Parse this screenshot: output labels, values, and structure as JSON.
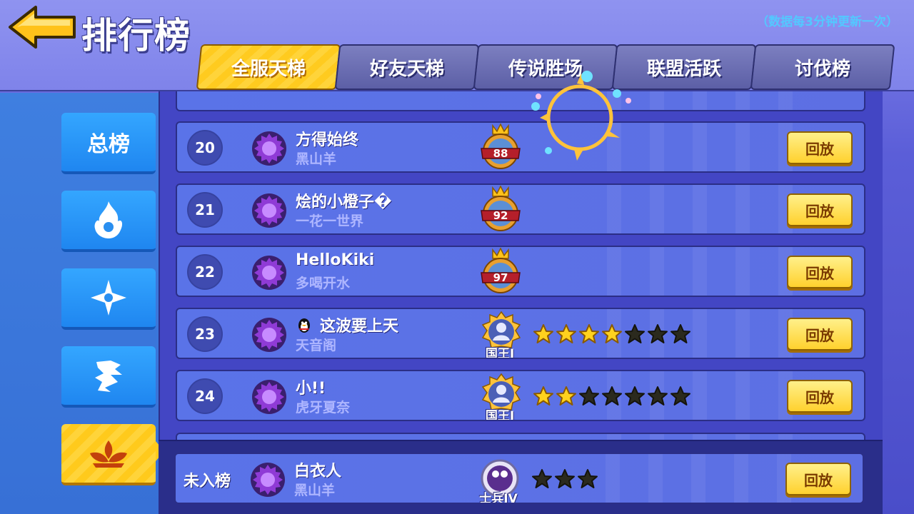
{
  "header": {
    "title": "排行榜",
    "update_note": "（数据每3分钟更新一次）"
  },
  "tabs": [
    {
      "label": "全服天梯",
      "active": true
    },
    {
      "label": "好友天梯",
      "active": false
    },
    {
      "label": "传说胜场",
      "active": false
    },
    {
      "label": "联盟活跃",
      "active": false
    },
    {
      "label": "讨伐榜",
      "active": false
    }
  ],
  "side": {
    "total_label": "总榜",
    "items": [
      {
        "icon": "flame-class-icon"
      },
      {
        "icon": "shuriken-class-icon"
      },
      {
        "icon": "dragon-class-icon"
      },
      {
        "icon": "lotus-class-icon",
        "active": true
      }
    ]
  },
  "rows": [
    {
      "rank": "20",
      "name": "方得始终",
      "guild": "黑山羊",
      "medal_level": "88",
      "tier": "",
      "stars_filled": 0,
      "stars_total": 0,
      "qq": false,
      "replay": "回放"
    },
    {
      "rank": "21",
      "name": "烩的小橙子�",
      "guild": "一花一世界",
      "medal_level": "92",
      "tier": "",
      "stars_filled": 0,
      "stars_total": 0,
      "qq": false,
      "replay": "回放"
    },
    {
      "rank": "22",
      "name": "HelloKiki",
      "guild": "多喝开水",
      "medal_level": "97",
      "tier": "",
      "stars_filled": 0,
      "stars_total": 0,
      "qq": false,
      "replay": "回放"
    },
    {
      "rank": "23",
      "name": "这波要上天",
      "guild": "天音阁",
      "medal_level": "",
      "tier": "国王I",
      "stars_filled": 4,
      "stars_total": 7,
      "qq": true,
      "replay": "回放"
    },
    {
      "rank": "24",
      "name": "小!!",
      "guild": "虎牙夏奈",
      "medal_level": "",
      "tier": "国王I",
      "stars_filled": 2,
      "stars_total": 7,
      "qq": false,
      "replay": "回放"
    }
  ],
  "my_row": {
    "rank": "未入榜",
    "name": "白衣人",
    "guild": "黑山羊",
    "tier": "士兵IV",
    "stars_filled": 0,
    "stars_total": 3,
    "replay": "回放"
  },
  "colors": {
    "accent_yellow": "#ffd12e",
    "note_blue": "#53c8ff",
    "side_blue": "#1f86f0"
  }
}
